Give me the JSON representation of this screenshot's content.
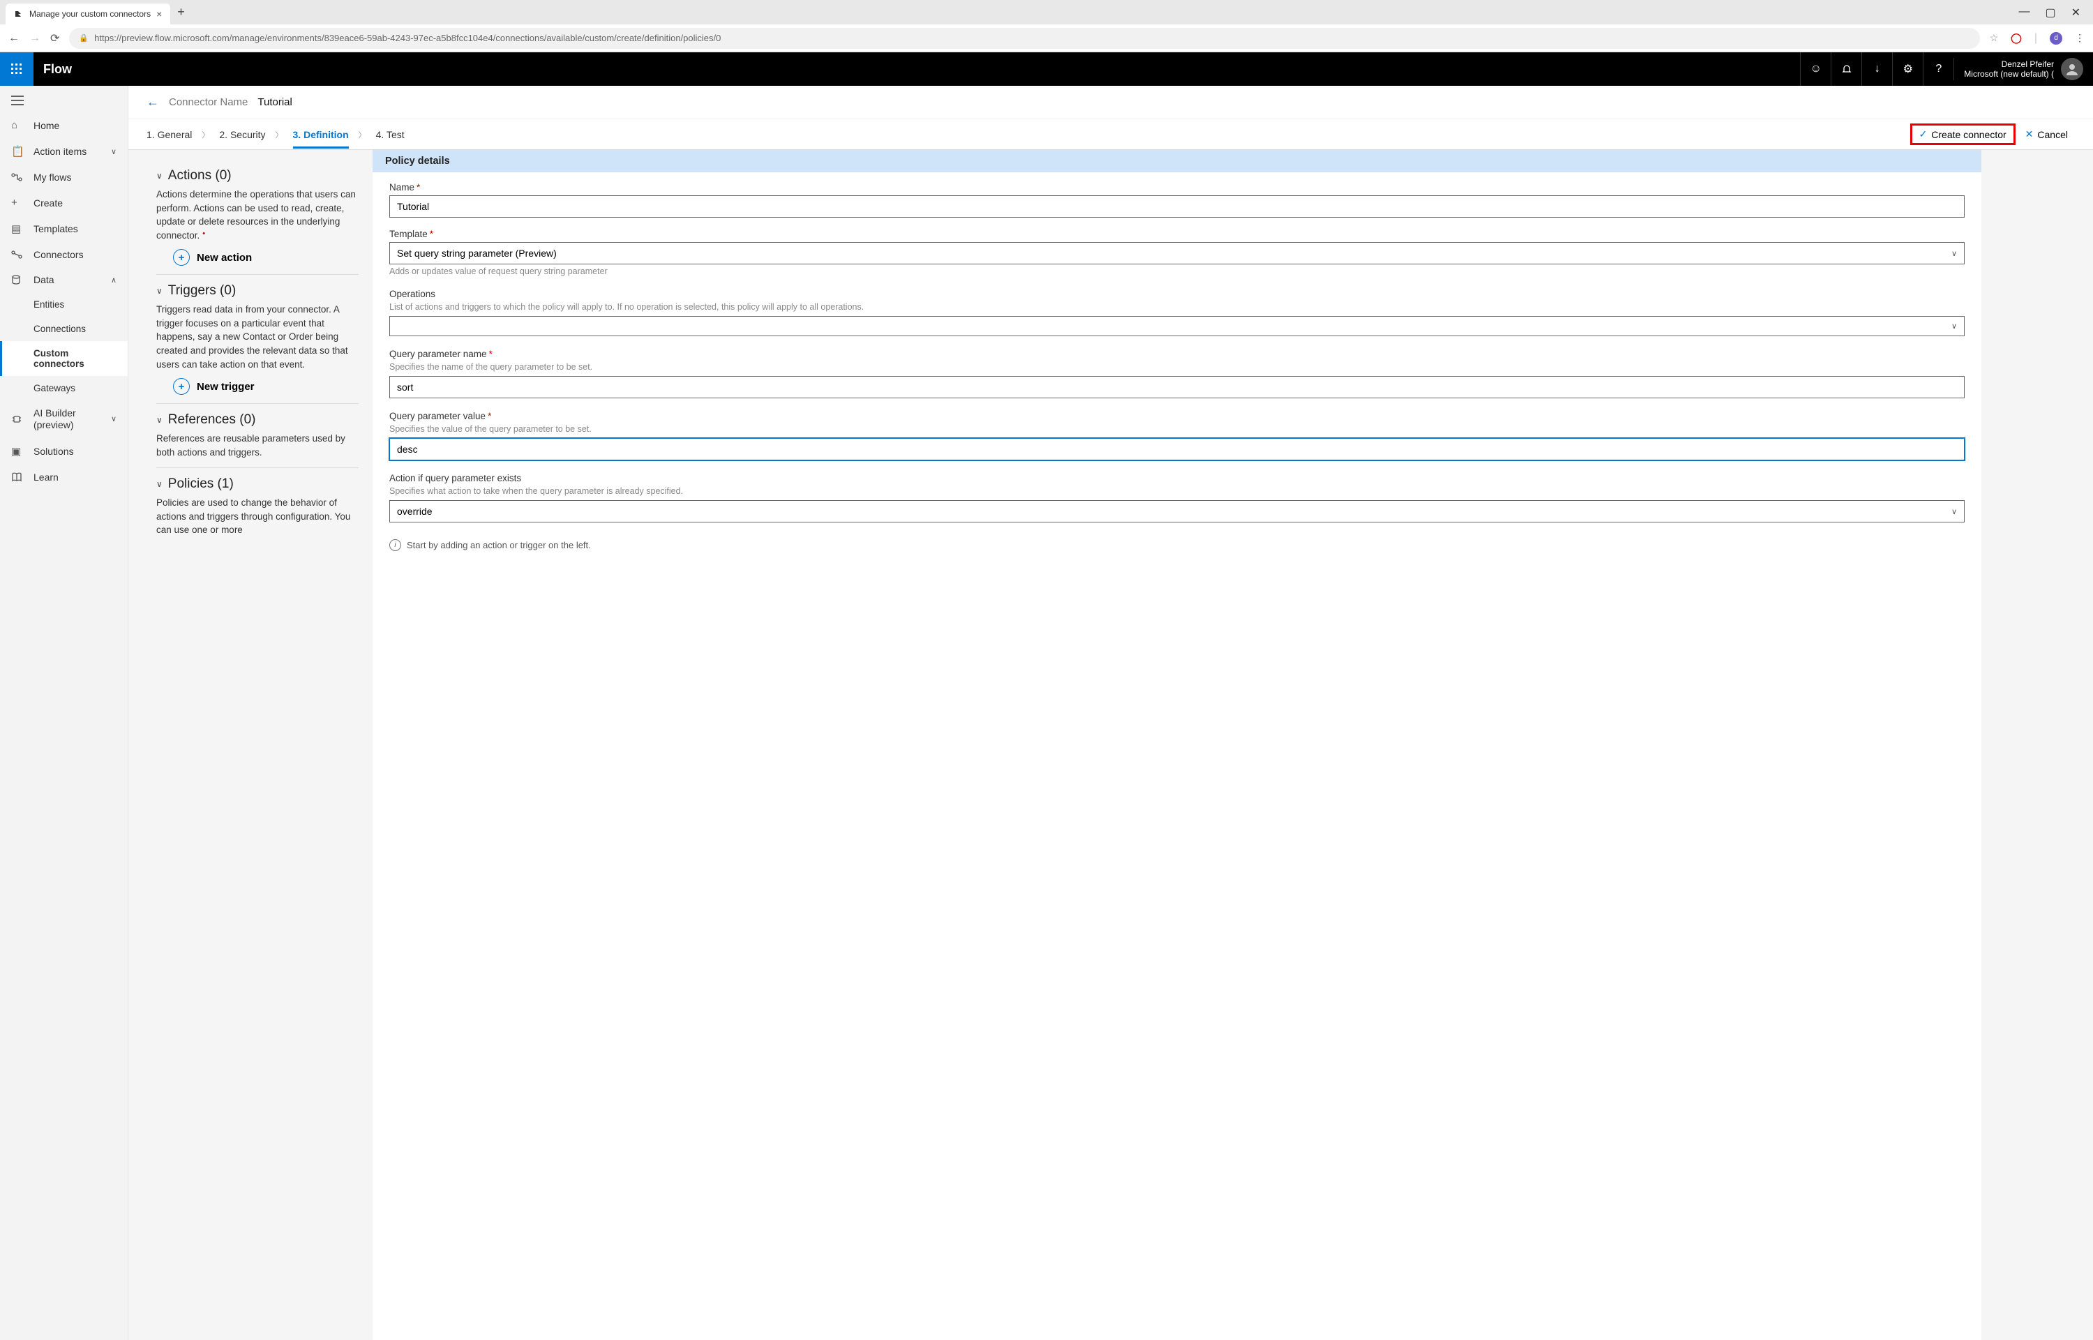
{
  "browser": {
    "tab_title": "Manage your custom connectors",
    "url": "https://preview.flow.microsoft.com/manage/environments/839eace6-59ab-4243-97ec-a5b8fcc104e4/connections/available/custom/create/definition/policies/0"
  },
  "topbar": {
    "app_name": "Flow",
    "user_name": "Denzel Pfeifer",
    "user_tenant": "Microsoft (new default) ("
  },
  "leftnav": {
    "items": [
      {
        "label": "Home"
      },
      {
        "label": "Action items",
        "chev": true
      },
      {
        "label": "My flows"
      },
      {
        "label": "Create"
      },
      {
        "label": "Templates"
      },
      {
        "label": "Connectors"
      },
      {
        "label": "Data",
        "chev": true,
        "expanded": true
      },
      {
        "label": "Entities",
        "sub": true
      },
      {
        "label": "Connections",
        "sub": true
      },
      {
        "label": "Custom connectors",
        "sub": true,
        "selected": true
      },
      {
        "label": "Gateways",
        "sub": true
      },
      {
        "label": "AI Builder (preview)",
        "chev": true,
        "twoLine": true
      },
      {
        "label": "Solutions"
      },
      {
        "label": "Learn"
      }
    ]
  },
  "header": {
    "label": "Connector Name",
    "value": "Tutorial"
  },
  "wizard": {
    "steps": [
      "1. General",
      "2. Security",
      "3. Definition",
      "4. Test"
    ],
    "active_index": 2,
    "create_label": "Create connector",
    "cancel_label": "Cancel"
  },
  "definitions": {
    "actions": {
      "title": "Actions (0)",
      "desc": "Actions determine the operations that users can perform. Actions can be used to read, create, update or delete resources in the underlying connector.",
      "marker": true,
      "button": "New action"
    },
    "triggers": {
      "title": "Triggers (0)",
      "desc": "Triggers read data in from your connector. A trigger focuses on a particular event that happens, say a new Contact or Order being created and provides the relevant data so that users can take action on that event.",
      "button": "New trigger"
    },
    "references": {
      "title": "References (0)",
      "desc": "References are reusable parameters used by both actions and triggers."
    },
    "policies": {
      "title": "Policies (1)",
      "desc": "Policies are used to change the behavior of actions and triggers through configuration. You can use one or more"
    }
  },
  "form": {
    "panel_title": "Policy details",
    "name": {
      "label": "Name",
      "value": "Tutorial"
    },
    "template": {
      "label": "Template",
      "value": "Set query string parameter (Preview)",
      "help": "Adds or updates value of request query string parameter"
    },
    "operations": {
      "label": "Operations",
      "help": "List of actions and triggers to which the policy will apply to. If no operation is selected, this policy will apply to all operations.",
      "value": ""
    },
    "qp_name": {
      "label": "Query parameter name",
      "help": "Specifies the name of the query parameter to be set.",
      "value": "sort"
    },
    "qp_value": {
      "label": "Query parameter value",
      "help": "Specifies the value of the query parameter to be set.",
      "value": "desc"
    },
    "qp_action": {
      "label": "Action if query parameter exists",
      "help": "Specifies what action to take when the query parameter is already specified.",
      "value": "override"
    },
    "hint": "Start by adding an action or trigger on the left."
  }
}
